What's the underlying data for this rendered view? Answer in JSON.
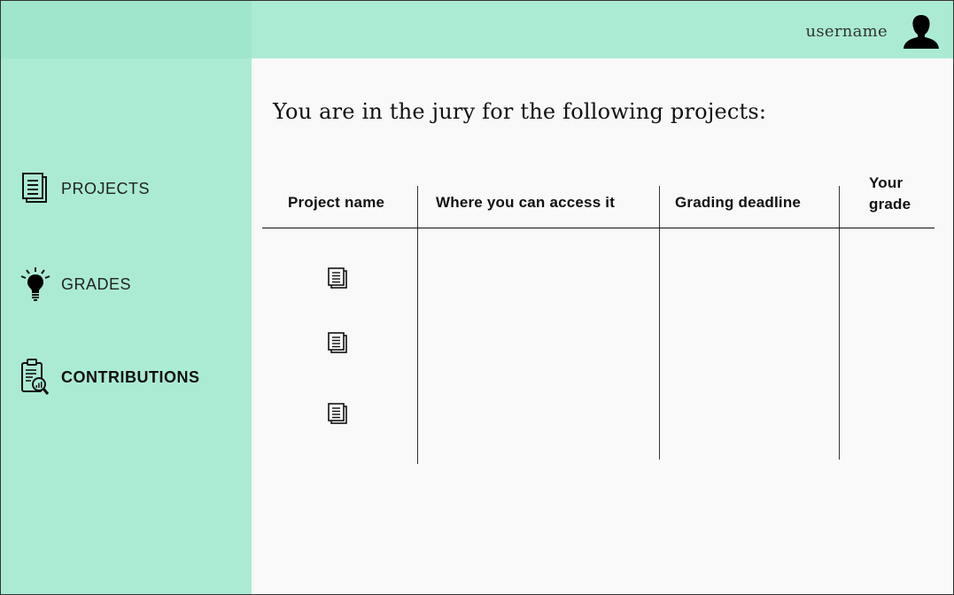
{
  "header": {
    "username": "username",
    "avatar_icon": "user-silhouette-icon"
  },
  "sidebar": {
    "items": [
      {
        "label": "PROJECTS",
        "icon": "document-icon",
        "active": false
      },
      {
        "label": "GRADES",
        "icon": "lightbulb-icon",
        "active": false
      },
      {
        "label": "CONTRIBUTIONS",
        "icon": "clipboard-search-icon",
        "active": true
      }
    ]
  },
  "main": {
    "heading": "You are in the jury for the following projects:",
    "table": {
      "columns": [
        "Project name",
        "Where you can access it",
        "Grading deadline",
        "Your grade"
      ],
      "rows": [
        {
          "project_icon": "document-icon"
        },
        {
          "project_icon": "document-icon"
        },
        {
          "project_icon": "document-icon"
        }
      ]
    }
  },
  "colors": {
    "accent": "#abebd4",
    "accent_dark": "#9fe6cc",
    "background": "#f9f9f9"
  }
}
